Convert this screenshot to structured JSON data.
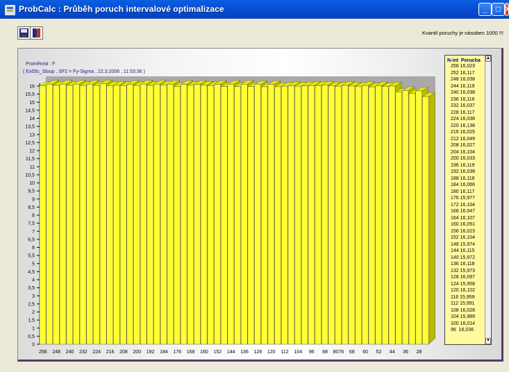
{
  "window": {
    "title": "ProbCalc : Průběh poruch intervalové optimalizace"
  },
  "toolbar": {
    "save_icon": "floppy-disk-icon",
    "info_icon": "book-info-icon"
  },
  "note": "Kvantil poruchy je násoben 1000 !!!",
  "chart": {
    "variable_label": "Proměnná :   F",
    "case_label": "( Ex05c_Sloup , SF2 = Fy-Sigma , 22.3.2006 , 11:53:36 )"
  },
  "chart_data": {
    "type": "bar",
    "categories": [
      "256",
      "252",
      "248",
      "244",
      "240",
      "236",
      "232",
      "228",
      "224",
      "220",
      "216",
      "212",
      "208",
      "204",
      "200",
      "196",
      "192",
      "188",
      "184",
      "180",
      "176",
      "172",
      "168",
      "164",
      "160",
      "156",
      "152",
      "148",
      "144",
      "140",
      "136",
      "132",
      "128",
      "124",
      "120",
      "116",
      "112",
      "108",
      "104",
      "100",
      "96",
      "92",
      "88",
      "84",
      "80",
      "76",
      "72",
      "68",
      "64",
      "60",
      "56",
      "52",
      "48",
      "44",
      "40",
      "36",
      "32",
      "28"
    ],
    "x_tick_labels": [
      "256",
      "248",
      "240",
      "232",
      "224",
      "216",
      "208",
      "200",
      "192",
      "184",
      "176",
      "168",
      "160",
      "152",
      "144",
      "136",
      "128",
      "120",
      "112",
      "104",
      "96",
      "88",
      "8076",
      "68",
      "60",
      "52",
      "44",
      "36",
      "28"
    ],
    "values": [
      16.023,
      16.117,
      16.038,
      16.119,
      16.038,
      16.116,
      16.037,
      16.117,
      16.038,
      16.138,
      16.025,
      16.049,
      16.027,
      16.104,
      16.033,
      16.119,
      16.038,
      16.118,
      16.066,
      16.117,
      15.977,
      16.104,
      16.047,
      16.107,
      16.051,
      16.023,
      16.104,
      15.974,
      16.115,
      15.972,
      16.118,
      15.973,
      16.097,
      15.958,
      16.102,
      15.959,
      15.991,
      16.028,
      15.989,
      16.014,
      16.036,
      16.02,
      16.05,
      16.01,
      15.99,
      16.04,
      16.0,
      15.98,
      16.03,
      15.95,
      16.02,
      15.97,
      16.0,
      15.62,
      15.72,
      15.55,
      15.7,
      15.35
    ],
    "y_ticks": [
      "0",
      "0,5",
      "1",
      "1,5",
      "2",
      "2,5",
      "3",
      "3,5",
      "4",
      "4,5",
      "5",
      "5,5",
      "6",
      "6,5",
      "7",
      "7,5",
      "8",
      "8,5",
      "9",
      "9,5",
      "10",
      "10,5",
      "11",
      "11,5",
      "12",
      "12,5",
      "13",
      "13,5",
      "14",
      "14,5",
      "15",
      "15,5",
      "16"
    ],
    "ylim": [
      0,
      16
    ],
    "colors": {
      "bar": "#ffff33",
      "bar_top": "#e8e800",
      "bar_side": "#b8b800",
      "back_wall": "#a9a9a9"
    }
  },
  "listbox": {
    "header": "N-int  Porucha",
    "rows": [
      "256 16,023",
      "252 16,117",
      "248 16,038",
      "244 16,119",
      "240 16,038",
      "236 16,116",
      "232 16,037",
      "228 16,117",
      "224 16,038",
      "220 16,138",
      "216 16,025",
      "212 16,049",
      "208 16,027",
      "204 16,104",
      "200 16,033",
      "196 16,119",
      "192 16,038",
      "188 16,118",
      "184 16,066",
      "180 16,117",
      "176 15,977",
      "172 16,104",
      "168 16,047",
      "164 16,107",
      "160 16,051",
      "156 16,023",
      "152 16,104",
      "148 15,974",
      "144 16,115",
      "140 15,972",
      "136 16,118",
      "132 15,973",
      "128 16,097",
      "124 15,958",
      "120 16,102",
      "116 15,959",
      "112 15,991",
      "108 16,028",
      "104 15,989",
      "100 16,014",
      "96  16,036"
    ]
  }
}
